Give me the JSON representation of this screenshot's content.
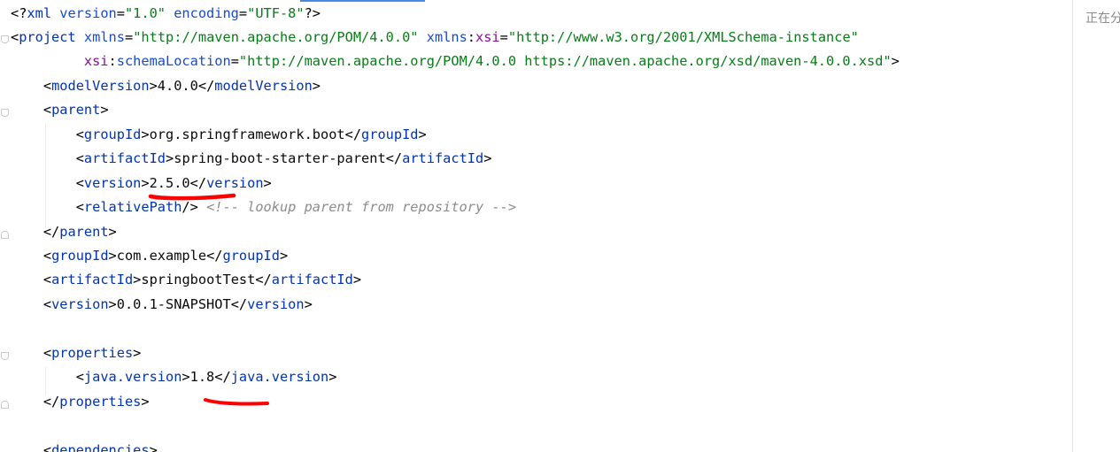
{
  "editor": {
    "side_panel_text": "正在分",
    "lines": [
      {
        "indent": 0,
        "tokens": [
          [
            "t-bracket",
            "<?"
          ],
          [
            "t-tag",
            "xml "
          ],
          [
            "t-attr",
            "version"
          ],
          [
            "t-bracket",
            "="
          ],
          [
            "t-str",
            "\"1.0\" "
          ],
          [
            "t-attr",
            "encoding"
          ],
          [
            "t-bracket",
            "="
          ],
          [
            "t-str",
            "\"UTF-8\""
          ],
          [
            "t-bracket",
            "?>"
          ]
        ]
      },
      {
        "indent": 0,
        "tokens": [
          [
            "t-bracket",
            "<"
          ],
          [
            "t-tag",
            "project "
          ],
          [
            "t-attr",
            "xmlns"
          ],
          [
            "t-bracket",
            "="
          ],
          [
            "t-str",
            "\"http://maven.apache.org/POM/4.0.0\" "
          ],
          [
            "t-attr",
            "xmlns"
          ],
          [
            "t-bracket",
            ":"
          ],
          [
            "t-ns",
            "xsi"
          ],
          [
            "t-bracket",
            "="
          ],
          [
            "t-str",
            "\"http://www.w3.org/2001/XMLSchema-instance\""
          ]
        ]
      },
      {
        "indent": 9,
        "tokens": [
          [
            "t-ns",
            "xsi"
          ],
          [
            "t-bracket",
            ":"
          ],
          [
            "t-attr",
            "schemaLocation"
          ],
          [
            "t-bracket",
            "="
          ],
          [
            "t-str",
            "\"http://maven.apache.org/POM/4.0.0 https://maven.apache.org/xsd/maven-4.0.0.xsd\""
          ],
          [
            "t-bracket",
            ">"
          ]
        ]
      },
      {
        "indent": 4,
        "tokens": [
          [
            "t-bracket",
            "<"
          ],
          [
            "t-tag",
            "modelVersion"
          ],
          [
            "t-bracket",
            ">"
          ],
          [
            "t-text",
            "4.0.0"
          ],
          [
            "t-bracket",
            "</"
          ],
          [
            "t-tag",
            "modelVersion"
          ],
          [
            "t-bracket",
            ">"
          ]
        ]
      },
      {
        "indent": 4,
        "tokens": [
          [
            "t-bracket",
            "<"
          ],
          [
            "t-tag",
            "parent"
          ],
          [
            "t-bracket",
            ">"
          ]
        ]
      },
      {
        "indent": 8,
        "tokens": [
          [
            "t-bracket",
            "<"
          ],
          [
            "t-tag",
            "groupId"
          ],
          [
            "t-bracket",
            ">"
          ],
          [
            "t-text",
            "org.springframework.boot"
          ],
          [
            "t-bracket",
            "</"
          ],
          [
            "t-tag",
            "groupId"
          ],
          [
            "t-bracket",
            ">"
          ]
        ]
      },
      {
        "indent": 8,
        "tokens": [
          [
            "t-bracket",
            "<"
          ],
          [
            "t-tag",
            "artifactId"
          ],
          [
            "t-bracket",
            ">"
          ],
          [
            "t-text",
            "spring-boot-starter-parent"
          ],
          [
            "t-bracket",
            "</"
          ],
          [
            "t-tag",
            "artifactId"
          ],
          [
            "t-bracket",
            ">"
          ]
        ]
      },
      {
        "indent": 8,
        "tokens": [
          [
            "t-bracket",
            "<"
          ],
          [
            "t-tag",
            "version"
          ],
          [
            "t-bracket",
            ">"
          ],
          [
            "t-text",
            "2.5.0"
          ],
          [
            "t-bracket",
            "</"
          ],
          [
            "t-tag",
            "version"
          ],
          [
            "t-bracket",
            ">"
          ]
        ]
      },
      {
        "indent": 8,
        "tokens": [
          [
            "t-bracket",
            "<"
          ],
          [
            "t-tag",
            "relativePath"
          ],
          [
            "t-bracket",
            "/> "
          ],
          [
            "t-comment",
            "<!-- lookup parent from repository -->"
          ]
        ]
      },
      {
        "indent": 4,
        "tokens": [
          [
            "t-bracket",
            "</"
          ],
          [
            "t-tag",
            "parent"
          ],
          [
            "t-bracket",
            ">"
          ]
        ]
      },
      {
        "indent": 4,
        "tokens": [
          [
            "t-bracket",
            "<"
          ],
          [
            "t-tag",
            "groupId"
          ],
          [
            "t-bracket",
            ">"
          ],
          [
            "t-text",
            "com.example"
          ],
          [
            "t-bracket",
            "</"
          ],
          [
            "t-tag",
            "groupId"
          ],
          [
            "t-bracket",
            ">"
          ]
        ]
      },
      {
        "indent": 4,
        "tokens": [
          [
            "t-bracket",
            "<"
          ],
          [
            "t-tag",
            "artifactId"
          ],
          [
            "t-bracket",
            ">"
          ],
          [
            "t-text",
            "springbootTest"
          ],
          [
            "t-bracket",
            "</"
          ],
          [
            "t-tag",
            "artifactId"
          ],
          [
            "t-bracket",
            ">"
          ]
        ]
      },
      {
        "indent": 4,
        "tokens": [
          [
            "t-bracket",
            "<"
          ],
          [
            "t-tag",
            "version"
          ],
          [
            "t-bracket",
            ">"
          ],
          [
            "t-text",
            "0.0.1-SNAPSHOT"
          ],
          [
            "t-bracket",
            "</"
          ],
          [
            "t-tag",
            "version"
          ],
          [
            "t-bracket",
            ">"
          ]
        ]
      },
      {
        "indent": 0,
        "tokens": []
      },
      {
        "indent": 4,
        "tokens": [
          [
            "t-bracket",
            "<"
          ],
          [
            "t-tag",
            "properties"
          ],
          [
            "t-bracket",
            ">"
          ]
        ]
      },
      {
        "indent": 8,
        "tokens": [
          [
            "t-bracket",
            "<"
          ],
          [
            "t-tag",
            "java.version"
          ],
          [
            "t-bracket",
            ">"
          ],
          [
            "t-text",
            "1.8"
          ],
          [
            "t-bracket",
            "</"
          ],
          [
            "t-tag",
            "java.version"
          ],
          [
            "t-bracket",
            ">"
          ]
        ]
      },
      {
        "indent": 4,
        "tokens": [
          [
            "t-bracket",
            "</"
          ],
          [
            "t-tag",
            "properties"
          ],
          [
            "t-bracket",
            ">"
          ]
        ]
      },
      {
        "indent": 0,
        "tokens": []
      },
      {
        "indent": 4,
        "tokens": [
          [
            "t-bracket",
            "<"
          ],
          [
            "t-tag",
            "dependencies"
          ],
          [
            "t-bracket",
            ">"
          ]
        ]
      }
    ]
  },
  "annotations": {
    "color": "#ff0000"
  }
}
